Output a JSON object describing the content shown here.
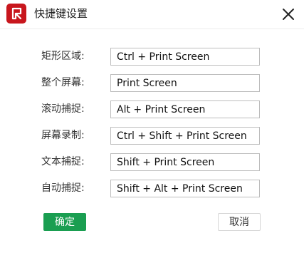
{
  "dialog": {
    "title": "快捷键设置",
    "logo_icon": "app-logo-icon",
    "close_icon": "close-icon",
    "accent_color": "#1a9e51",
    "logo_color": "#c8161d"
  },
  "shortcuts": [
    {
      "label": "矩形区域:",
      "value": "Ctrl + Print Screen"
    },
    {
      "label": "整个屏幕:",
      "value": "Print Screen"
    },
    {
      "label": "滚动捕捉:",
      "value": "Alt + Print Screen"
    },
    {
      "label": "屏幕录制:",
      "value": "Ctrl + Shift + Print Screen"
    },
    {
      "label": "文本捕捉:",
      "value": "Shift + Print Screen"
    },
    {
      "label": "自动捕捉:",
      "value": "Shift + Alt + Print Screen"
    }
  ],
  "buttons": {
    "confirm": "确定",
    "cancel": "取消"
  }
}
